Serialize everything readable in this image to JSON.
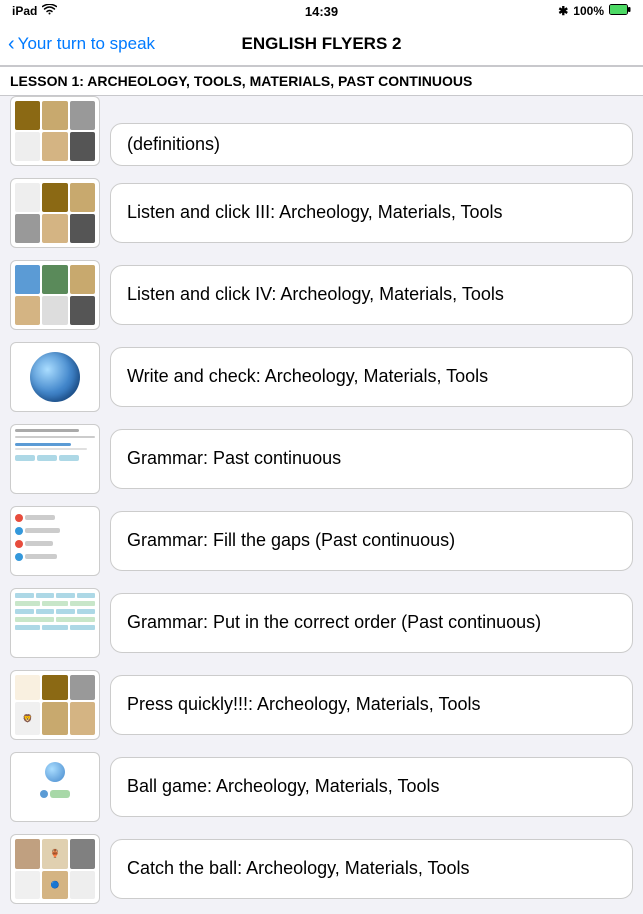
{
  "statusBar": {
    "left": "iPad",
    "time": "14:39",
    "battery": "100%",
    "wifi": true,
    "bluetooth": true
  },
  "navBar": {
    "backLabel": "Your turn to speak",
    "title": "ENGLISH FLYERS 2"
  },
  "lessonHeader": "LESSON 1: ARCHEOLOGY, TOOLS, MATERIALS, PAST CONTINUOUS",
  "partialRow": {
    "label": "(definitions)"
  },
  "listItems": [
    {
      "id": 1,
      "label": "Listen and click III: Archeology, Materials, Tools",
      "thumbType": "grid3"
    },
    {
      "id": 2,
      "label": "Listen and click IV: Archeology, Materials, Tools",
      "thumbType": "grid4"
    },
    {
      "id": 3,
      "label": "Write and check: Archeology, Materials, Tools",
      "thumbType": "ball"
    },
    {
      "id": 4,
      "label": "Grammar: Past continuous",
      "thumbType": "form"
    },
    {
      "id": 5,
      "label": "Grammar: Fill the gaps (Past continuous)",
      "thumbType": "gaps"
    },
    {
      "id": 6,
      "label": "Grammar: Put in the correct order (Past continuous)",
      "thumbType": "order"
    },
    {
      "id": 7,
      "label": "Press quickly!!!: Archeology, Materials, Tools",
      "thumbType": "press"
    },
    {
      "id": 8,
      "label": "Ball game: Archeology, Materials, Tools",
      "thumbType": "ballgame"
    },
    {
      "id": 9,
      "label": "Catch the ball: Archeology, Materials, Tools",
      "thumbType": "catchball"
    }
  ]
}
